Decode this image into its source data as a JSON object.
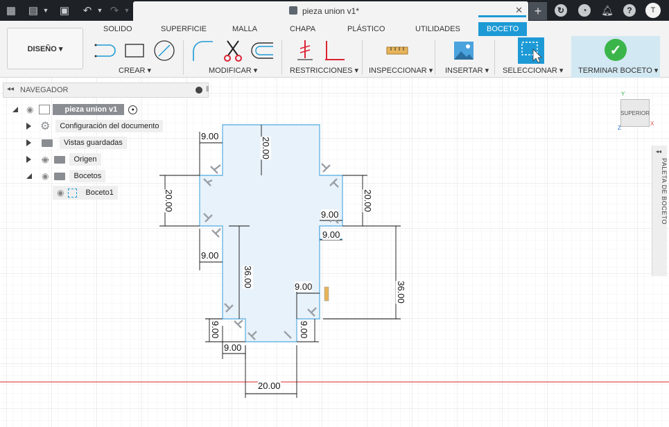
{
  "app": {
    "doc_title": "pieza union v1*",
    "user_initial": "T"
  },
  "toolbar": {
    "design_label": "DISEÑO ▾",
    "tabs": [
      {
        "label": "SOLIDO"
      },
      {
        "label": "SUPERFICIE"
      },
      {
        "label": "MALLA"
      },
      {
        "label": "CHAPA"
      },
      {
        "label": "PLÁSTICO"
      },
      {
        "label": "UTILIDADES"
      },
      {
        "label": "BOCETO",
        "active": true
      }
    ],
    "groups": {
      "crear": "CREAR ▾",
      "modificar": "MODIFICAR ▾",
      "restricciones": "RESTRICCIONES ▾",
      "inspeccionar": "INSPECCIONAR ▾",
      "insertar": "INSERTAR ▾",
      "seleccionar": "SELECCIONAR ▾",
      "terminar": "TERMINAR BOCETO ▾"
    }
  },
  "browser": {
    "title": "NAVEGADOR",
    "root": "pieza union v1",
    "items": [
      {
        "label": "Configuración del documento"
      },
      {
        "label": "Vistas guardadas"
      },
      {
        "label": "Origen"
      },
      {
        "label": "Bocetos"
      },
      {
        "label": "Boceto1"
      }
    ]
  },
  "viewcube": {
    "face": "SUPERIOR"
  },
  "palette": {
    "label": "PALETA DE BOCETO"
  },
  "dimensions": [
    "9.00",
    "20.00",
    "20.00",
    "20.00",
    "9.00",
    "9.00",
    "9.00",
    "36.00",
    "36.00",
    "9.00",
    "9.00",
    "9.00",
    "20.00"
  ],
  "colors": {
    "accent": "#1d9ad6",
    "sketch_fill": "#e8f2fa",
    "sketch_line": "#6ab6e3",
    "axis_red": "#e05050",
    "finish_green": "#3bb54a"
  }
}
